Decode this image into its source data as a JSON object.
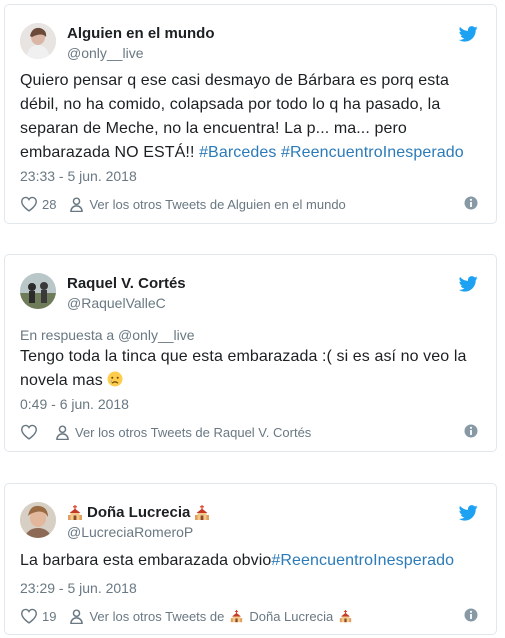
{
  "tweets": [
    {
      "name": "Alguien en el mundo",
      "handle": "@only__live",
      "text_main": "Quiero pensar q ese casi desmayo de Bárbara es porq esta débil, no ha comido, colapsada por todo lo q ha pasado, la separan de Meche, no la encuentra! La p... ma... pero embarazada NO ESTÁ!! ",
      "hashtag1": "#Barcedes",
      "hashtag2": "#ReencuentroInesperado",
      "date": "23:33 - 5 jun. 2018",
      "likes": "28",
      "profile_link": "Ver los otros Tweets de Alguien en el mundo"
    },
    {
      "name": "Raquel V. Cortés",
      "handle": "@RaquelValleC",
      "reply_to": "En respuesta a @only__live",
      "text_main": "Tengo toda la tinca que esta embarazada :( si es así no veo la novela mas ",
      "emoji": "😢",
      "date": "0:49 - 6 jun. 2018",
      "likes": "",
      "profile_link": "Ver los otros Tweets de Raquel V. Cortés"
    },
    {
      "name": "Doña Lucrecia",
      "handle": "@LucreciaRomeroP",
      "text_main": "La barbara esta embarazada obvio",
      "hashtag1": "#ReencuentroInesperado",
      "date": "23:29 - 5 jun. 2018",
      "likes": "19",
      "profile_link_prefix": "Ver los otros Tweets de ",
      "profile_link_name": "Doña Lucrecia"
    }
  ],
  "icons": {
    "bird": "twitter-bird-icon",
    "heart": "heart-icon",
    "person": "person-icon",
    "info": "info-icon",
    "church": "church-emoji-icon"
  },
  "colors": {
    "twitter_blue": "#1da1f2",
    "link": "#2b7bb9",
    "muted": "#697882",
    "text": "#1c2022"
  }
}
